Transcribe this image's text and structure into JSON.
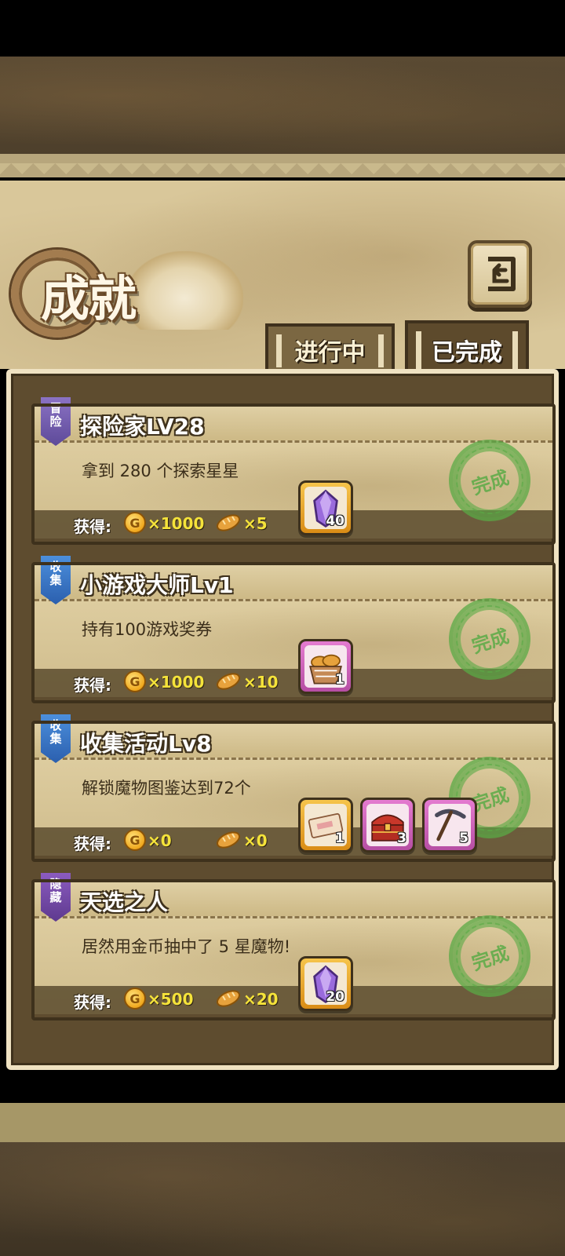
{
  "screen": {
    "title": "成就"
  },
  "tabs": [
    {
      "label": "进行中",
      "active": false
    },
    {
      "label": "已完成",
      "active": true
    }
  ],
  "reward_label": "获得:",
  "stamp_text": "完成",
  "coin_symbol": "G",
  "achievements": [
    {
      "category": "冒险",
      "category_color": "#6e58ad",
      "title": "探险家LV28",
      "description": "拿到 280 个探索星星",
      "coins": "×1000",
      "bread": "×5",
      "items": [
        {
          "icon": "purple-gem-icon",
          "count": "40",
          "frame": "gold"
        }
      ]
    },
    {
      "category": "收集",
      "category_color": "#3a74c4",
      "title": "小游戏大师Lv1",
      "description": "持有100游戏奖券",
      "coins": "×1000",
      "bread": "×10",
      "items": [
        {
          "icon": "bread-basket-icon",
          "count": "1",
          "frame": "pink"
        }
      ]
    },
    {
      "category": "收集",
      "category_color": "#3a74c4",
      "title": "收集活动Lv8",
      "description": "解锁魔物图鉴达到72个",
      "coins": "×0",
      "bread": "×0",
      "items": [
        {
          "icon": "ticket-icon",
          "count": "1",
          "frame": "gold"
        },
        {
          "icon": "treasure-chest-icon",
          "count": "3",
          "frame": "pink"
        },
        {
          "icon": "pickaxe-icon",
          "count": "5",
          "frame": "pink"
        }
      ]
    },
    {
      "category": "隐藏",
      "category_color": "#764aa6",
      "title": "天选之人",
      "description": "居然用金币抽中了 5 星魔物!",
      "coins": "×500",
      "bread": "×20",
      "items": [
        {
          "icon": "purple-gem-icon",
          "count": "20",
          "frame": "gold"
        }
      ]
    }
  ]
}
